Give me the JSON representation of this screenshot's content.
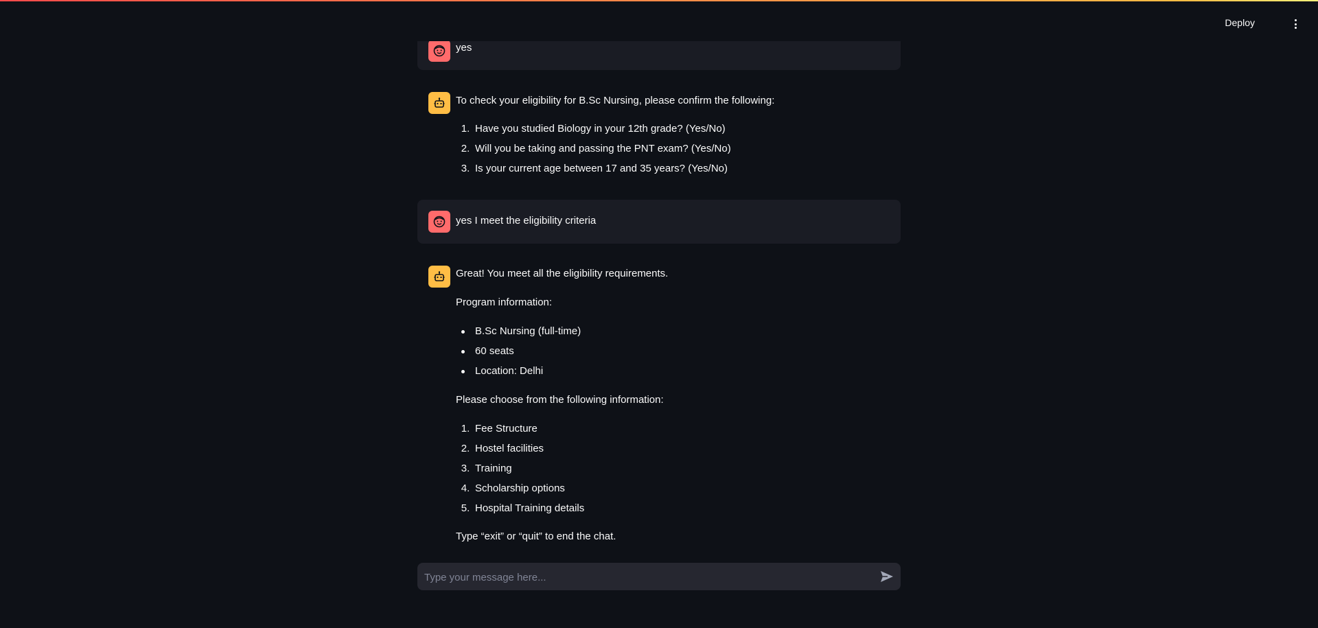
{
  "header": {
    "deploy_label": "Deploy",
    "menu_icon": "kebab-menu-icon"
  },
  "colors": {
    "background": "#0e1117",
    "user_avatar": "#ff6b6b",
    "bot_avatar": "#ffbd45",
    "user_bubble": "#1a1c24",
    "input_bg": "#262730"
  },
  "messages": [
    {
      "role": "user",
      "avatar_icon": "user-face-icon",
      "text": "yes"
    },
    {
      "role": "assistant",
      "avatar_icon": "robot-icon",
      "intro": "To check your eligibility for B.Sc Nursing, please confirm the following:",
      "items": [
        "Have you studied Biology in your 12th grade? (Yes/No)",
        "Will you be taking and passing the PNT exam? (Yes/No)",
        "Is your current age between 17 and 35 years? (Yes/No)"
      ]
    },
    {
      "role": "user",
      "avatar_icon": "user-face-icon",
      "text": "yes I meet the eligibility criteria"
    },
    {
      "role": "assistant",
      "avatar_icon": "robot-icon",
      "intro": "Great! You meet all the eligibility requirements.",
      "program_heading": "Program information:",
      "program_items": [
        "B.Sc Nursing (full-time)",
        "60 seats",
        "Location: Delhi"
      ],
      "choose_heading": "Please choose from the following information:",
      "choose_items": [
        "Fee Structure",
        "Hostel facilities",
        "Training",
        "Scholarship options",
        "Hospital Training details"
      ],
      "footer": "Type “exit” or “quit” to end the chat."
    }
  ],
  "list_markers": [
    "1.",
    "2.",
    "3.",
    "4.",
    "5."
  ],
  "input": {
    "placeholder": "Type your message here...",
    "value": "",
    "send_icon": "send-icon"
  }
}
